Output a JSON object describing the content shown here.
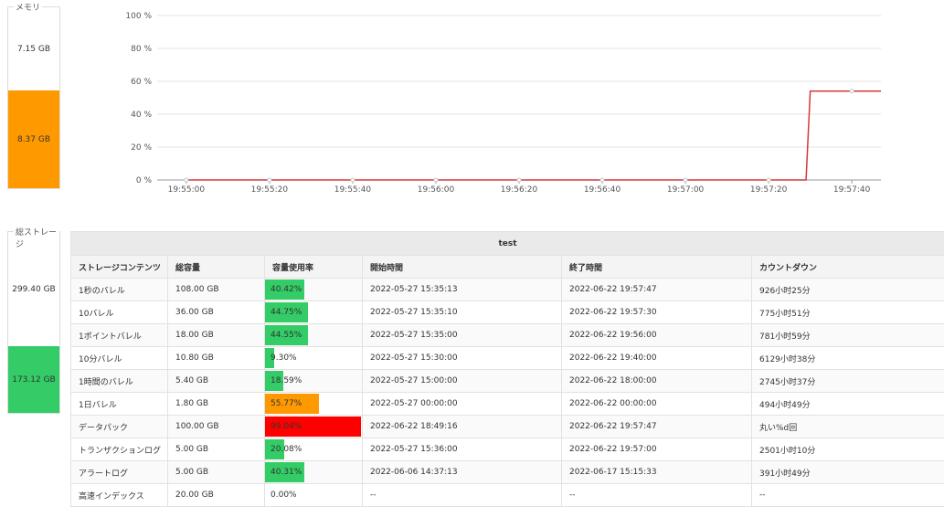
{
  "memory": {
    "legend": "メモリ",
    "free_label": "7.15 GB",
    "used_label": "8.37 GB",
    "used_fraction": 0.5393,
    "used_color": "#ff9900"
  },
  "storage": {
    "legend": "総ストレージ",
    "free_label": "299.40 GB",
    "used_label": "173.12 GB",
    "used_fraction": 0.3664,
    "used_color": "#33cc66"
  },
  "chart_data": {
    "type": "line",
    "y_unit": "%",
    "ylim": [
      0,
      100
    ],
    "yticks": [
      "0 %",
      "20 %",
      "40 %",
      "60 %",
      "80 %",
      "100 %"
    ],
    "ytick_values": [
      0,
      20,
      40,
      60,
      80,
      100
    ],
    "xticks": [
      "19:55:00",
      "19:55:20",
      "19:55:40",
      "19:56:00",
      "19:56:20",
      "19:56:40",
      "19:57:00",
      "19:57:20",
      "19:57:40"
    ],
    "xlim_seconds": [
      -7,
      167
    ],
    "grid": true,
    "series": [
      {
        "color": "#d43a3a",
        "points": [
          [
            "19:55:00",
            0
          ],
          [
            "19:55:20",
            0
          ],
          [
            "19:55:40",
            0
          ],
          [
            "19:56:00",
            0
          ],
          [
            "19:56:20",
            0
          ],
          [
            "19:56:40",
            0
          ],
          [
            "19:57:00",
            0
          ],
          [
            "19:57:20",
            0
          ],
          [
            "19:57:29",
            0
          ],
          [
            "19:57:30",
            54
          ],
          [
            "19:57:40",
            54
          ],
          [
            "19:57:47",
            54
          ]
        ]
      }
    ]
  },
  "table": {
    "title": "test",
    "columns": [
      "ストレージコンテンツ",
      "総容量",
      "容量使用率",
      "開始時間",
      "終了時間",
      "カウントダウン"
    ],
    "rows": [
      {
        "name": "1秒のバレル",
        "total": "108.00 GB",
        "rate_label": "40.42%",
        "rate": 40.42,
        "color": "#33cc66",
        "start": "2022-05-27 15:35:13",
        "end": "2022-06-22 19:57:47",
        "countdown": "926小时25分"
      },
      {
        "name": "10バレル",
        "total": "36.00 GB",
        "rate_label": "44.75%",
        "rate": 44.75,
        "color": "#33cc66",
        "start": "2022-05-27 15:35:10",
        "end": "2022-06-22 19:57:30",
        "countdown": "775小时51分"
      },
      {
        "name": "1ポイントバレル",
        "total": "18.00 GB",
        "rate_label": "44.55%",
        "rate": 44.55,
        "color": "#33cc66",
        "start": "2022-05-27 15:35:00",
        "end": "2022-06-22 19:56:00",
        "countdown": "781小时59分"
      },
      {
        "name": "10分バレル",
        "total": "10.80 GB",
        "rate_label": "9.30%",
        "rate": 9.3,
        "color": "#33cc66",
        "start": "2022-05-27 15:30:00",
        "end": "2022-06-22 19:40:00",
        "countdown": "6129小时38分"
      },
      {
        "name": "1時間のバレル",
        "total": "5.40 GB",
        "rate_label": "18.59%",
        "rate": 18.59,
        "color": "#33cc66",
        "start": "2022-05-27 15:00:00",
        "end": "2022-06-22 18:00:00",
        "countdown": "2745小时37分"
      },
      {
        "name": "1日バレル",
        "total": "1.80 GB",
        "rate_label": "55.77%",
        "rate": 55.77,
        "color": "#ff9900",
        "start": "2022-05-27 00:00:00",
        "end": "2022-06-22 00:00:00",
        "countdown": "494小时49分"
      },
      {
        "name": "データパック",
        "total": "100.00 GB",
        "rate_label": "99.04%",
        "rate": 99.04,
        "color": "#ff0000",
        "start": "2022-06-22 18:49:16",
        "end": "2022-06-22 19:57:47",
        "countdown": "丸い%d回"
      },
      {
        "name": "トランザクションログ",
        "total": "5.00 GB",
        "rate_label": "20.08%",
        "rate": 20.08,
        "color": "#33cc66",
        "start": "2022-05-27 15:36:00",
        "end": "2022-06-22 19:57:00",
        "countdown": "2501小时10分"
      },
      {
        "name": "アラートログ",
        "total": "5.00 GB",
        "rate_label": "40.31%",
        "rate": 40.31,
        "color": "#33cc66",
        "start": "2022-06-06 14:37:13",
        "end": "2022-06-17 15:15:33",
        "countdown": "391小时49分"
      },
      {
        "name": "高速インデックス",
        "total": "20.00 GB",
        "rate_label": "0.00%",
        "rate": 0,
        "color": "#33cc66",
        "start": "--",
        "end": "--",
        "countdown": "--"
      }
    ]
  }
}
